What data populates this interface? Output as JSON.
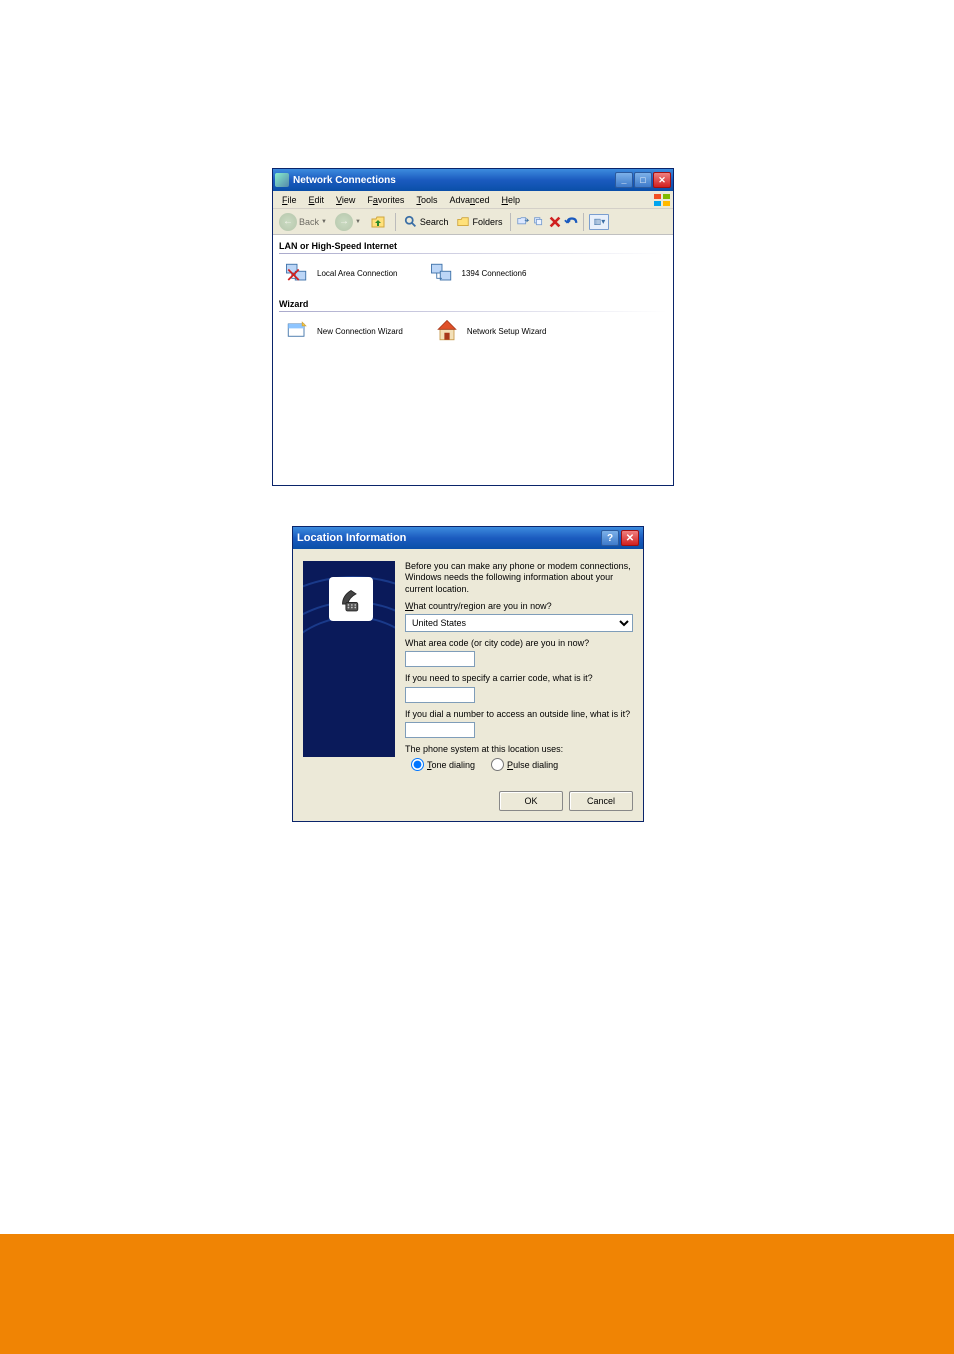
{
  "window": {
    "title": "Network Connections",
    "menubar": [
      "File",
      "Edit",
      "View",
      "Favorites",
      "Tools",
      "Advanced",
      "Help"
    ],
    "toolbar": {
      "back_label": "Back",
      "search_label": "Search",
      "folders_label": "Folders"
    },
    "sections": {
      "lan": {
        "header": "LAN or High-Speed Internet",
        "item1": "Local Area Connection",
        "item2": "1394 Connection6"
      },
      "wizard": {
        "header": "Wizard",
        "item1": "New Connection Wizard",
        "item2": "Network Setup Wizard"
      }
    }
  },
  "dialog": {
    "title": "Location Information",
    "intro": "Before you can make any phone or modem connections, Windows needs the following information about your current location.",
    "q_country": "What country/region are you in now?",
    "country_value": "United States",
    "q_areacode": "What area code (or city code) are you in now?",
    "areacode_value": "",
    "q_carrier": "If you need to specify a carrier code, what is it?",
    "carrier_value": "",
    "q_outside": "If you dial a number to access an outside line, what is it?",
    "outside_value": "",
    "phone_system_label": "The phone system at this location uses:",
    "tone_label": "Tone dialing",
    "pulse_label": "Pulse dialing",
    "ok_label": "OK",
    "cancel_label": "Cancel"
  }
}
